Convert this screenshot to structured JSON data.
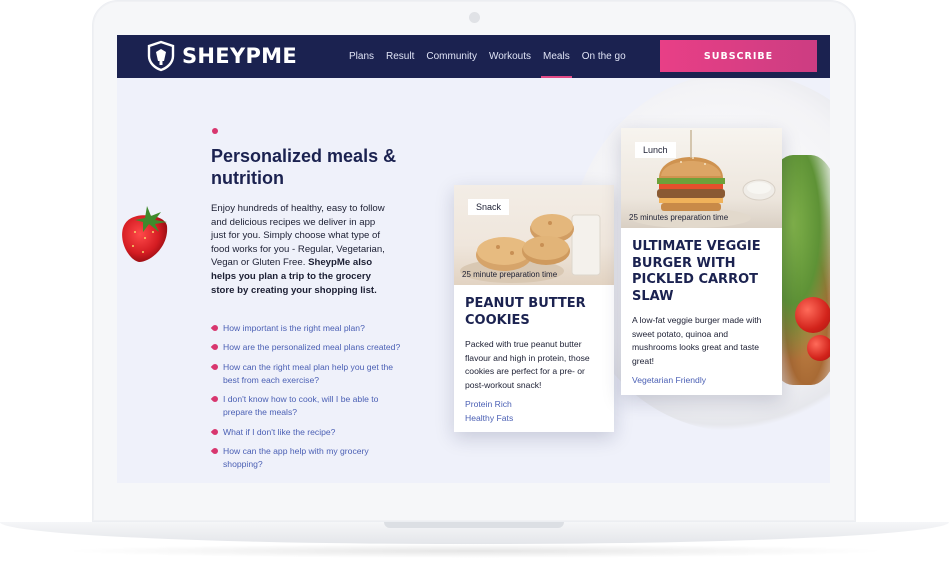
{
  "brand": {
    "name": "SHEYPME",
    "accent": "#e24a86",
    "navy": "#1b2250"
  },
  "nav": {
    "items": [
      "Plans",
      "Result",
      "Community",
      "Workouts",
      "Meals",
      "On the go"
    ],
    "active": "Meals",
    "subscribe_label": "SUBSCRIBE"
  },
  "hero": {
    "title": "Personalized meals & nutrition",
    "lead": "Enjoy hundreds of healthy, easy to follow and delicious recipes we deliver in app just for you. Simply choose what type of food works for you - Regular, Vegetarian, Vegan or Gluten Free.",
    "lead_bold": "SheypMe also helps you plan a trip to the grocery store by creating your shopping list."
  },
  "faq": [
    "How important is the right meal plan?",
    "How are the personalized meal plans created?",
    "How can the right meal plan help you get the best from each exercise?",
    "I don't know how to cook, will I be able to prepare the meals?",
    "What if I don't like the recipe?",
    "How can the app help with my grocery shopping?"
  ],
  "cards": [
    {
      "category": "Snack",
      "prep": "25 minute preparation time",
      "title": "Peanut Butter Cookies",
      "description": "Packed with true peanut butter flavour and high in protein, those cookies are perfect for a pre- or post-workout snack!",
      "tags": [
        "Protein Rich",
        "Healthy Fats"
      ]
    },
    {
      "category": "Lunch",
      "prep": "25 minutes preparation time",
      "title": "Ultimate Veggie Burger With Pickled Carrot Slaw",
      "description": "A low-fat veggie burger made with sweet potato, quinoa and mushrooms looks great and taste great!",
      "tags": [
        "Vegetarian Friendly"
      ]
    }
  ],
  "icons": [
    "shield-logo-icon",
    "faq-bullet-icon",
    "strawberry-image",
    "cookies-image",
    "burger-image"
  ]
}
